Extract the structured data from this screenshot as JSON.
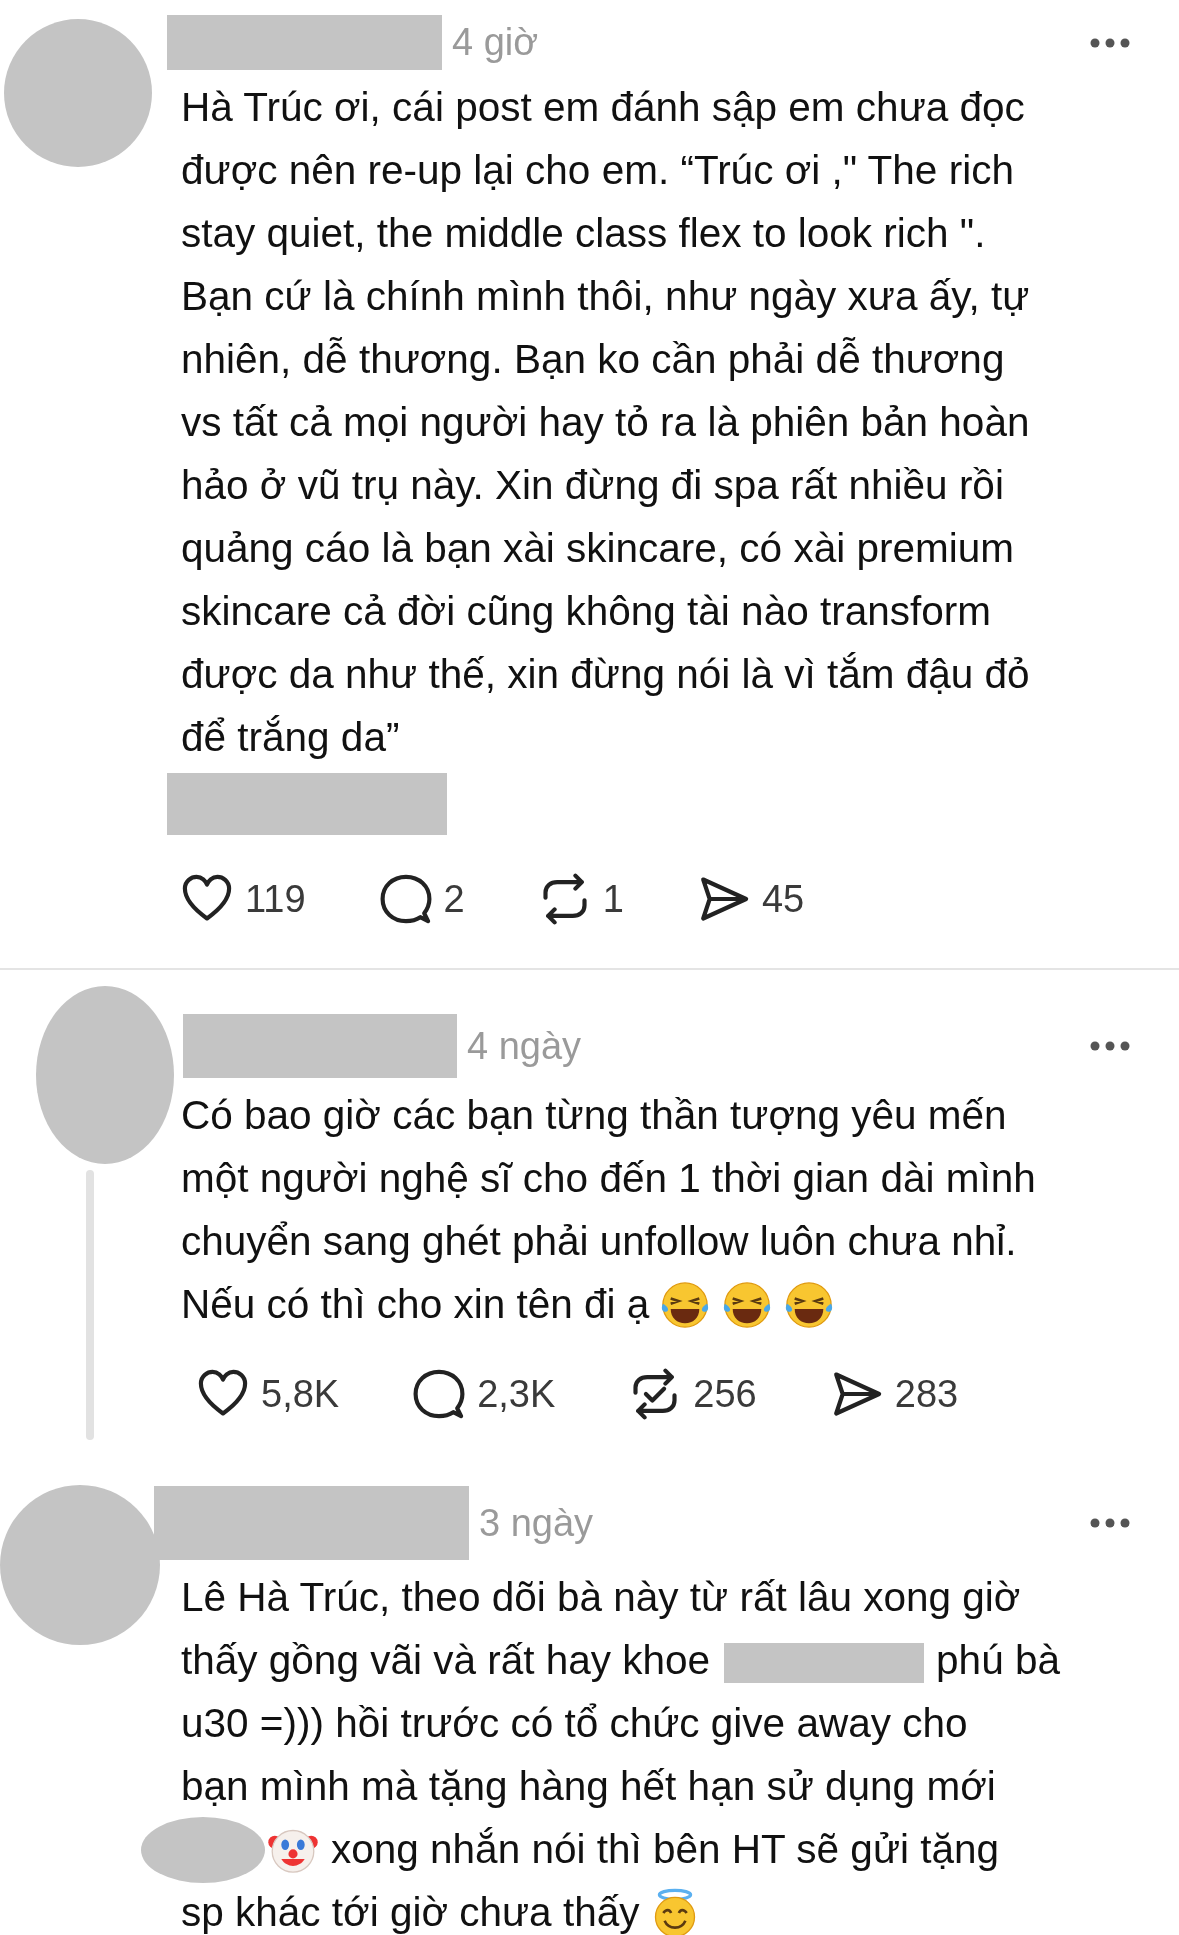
{
  "posts": [
    {
      "time": "4 giờ",
      "attachment_redacted": true,
      "lines": [
        [
          {
            "kind": "text",
            "text": "Hà Trúc ơi, cái post em đánh sập em chưa đọc"
          }
        ],
        [
          {
            "kind": "text",
            "text": "được nên re-up lại cho em. “Trúc ơi ,\" The rich"
          }
        ],
        [
          {
            "kind": "text",
            "text": "stay quiet, the middle class flex to look rich \"."
          }
        ],
        [
          {
            "kind": "text",
            "text": "Bạn cứ là chính mình thôi, như ngày xưa ấy, tự"
          }
        ],
        [
          {
            "kind": "text",
            "text": "nhiên, dễ thương. Bạn ko cần phải dễ thương"
          }
        ],
        [
          {
            "kind": "text",
            "text": "vs tất cả mọi người hay tỏ ra là phiên bản hoàn"
          }
        ],
        [
          {
            "kind": "text",
            "text": "hảo ở vũ trụ này. Xin đừng đi spa rất nhiều rồi"
          }
        ],
        [
          {
            "kind": "text",
            "text": "quảng cáo là bạn xài skincare, có xài premium"
          }
        ],
        [
          {
            "kind": "text",
            "text": "skincare cả đời cũng không tài nào transform"
          }
        ],
        [
          {
            "kind": "text",
            "text": "được da như thế, xin đừng nói là vì tắm đậu đỏ"
          }
        ],
        [
          {
            "kind": "text",
            "text": "để trắng da”"
          }
        ]
      ],
      "actions": [
        {
          "kind": "like",
          "count": "119"
        },
        {
          "kind": "reply",
          "count": "2"
        },
        {
          "kind": "repost",
          "count": "1",
          "reposted": false
        },
        {
          "kind": "share",
          "count": "45"
        }
      ]
    },
    {
      "time": "4 ngày",
      "thread_line": true,
      "lines": [
        [
          {
            "kind": "text",
            "text": "Có bao giờ các bạn từng thần tượng yêu mến"
          }
        ],
        [
          {
            "kind": "text",
            "text": "một người nghệ sĩ cho đến 1 thời gian dài mình"
          }
        ],
        [
          {
            "kind": "text",
            "text": "chuyển sang ghét phải unfollow luôn chưa nhỉ."
          }
        ],
        [
          {
            "kind": "text",
            "text": "Nếu có thì cho xin tên đi ạ"
          },
          {
            "kind": "laugh_emoji"
          },
          {
            "kind": "laugh_emoji"
          },
          {
            "kind": "laugh_emoji"
          }
        ]
      ],
      "actions": [
        {
          "kind": "like",
          "count": "5,8K"
        },
        {
          "kind": "reply",
          "count": "2,3K"
        },
        {
          "kind": "repost",
          "count": "256",
          "reposted": true
        },
        {
          "kind": "share",
          "count": "283"
        }
      ]
    },
    {
      "time": "3 ngày",
      "lines": [
        [
          {
            "kind": "text",
            "text": "Lê Hà Trúc, theo dõi bà này từ rất lâu xong giờ"
          }
        ],
        [
          {
            "kind": "text",
            "text": "thấy gồng vãi và rất hay khoe"
          },
          {
            "kind": "redaction"
          },
          {
            "kind": "text",
            "text": "phú bà"
          }
        ],
        [
          {
            "kind": "text",
            "text": "u30 =))) hồi trước có tổ chức give away cho"
          }
        ],
        [
          {
            "kind": "text",
            "text": "bạn mình mà tặng hàng hết hạn sử dụng mới"
          }
        ],
        [
          {
            "kind": "blot"
          },
          {
            "kind": "clown_emoji"
          },
          {
            "kind": "text",
            "text": "xong nhắn nói thì bên HT sẽ gửi tặng"
          }
        ],
        [
          {
            "kind": "text",
            "text": "sp khác tới giờ chưa thấy"
          },
          {
            "kind": "halo_emoji"
          }
        ]
      ]
    }
  ]
}
